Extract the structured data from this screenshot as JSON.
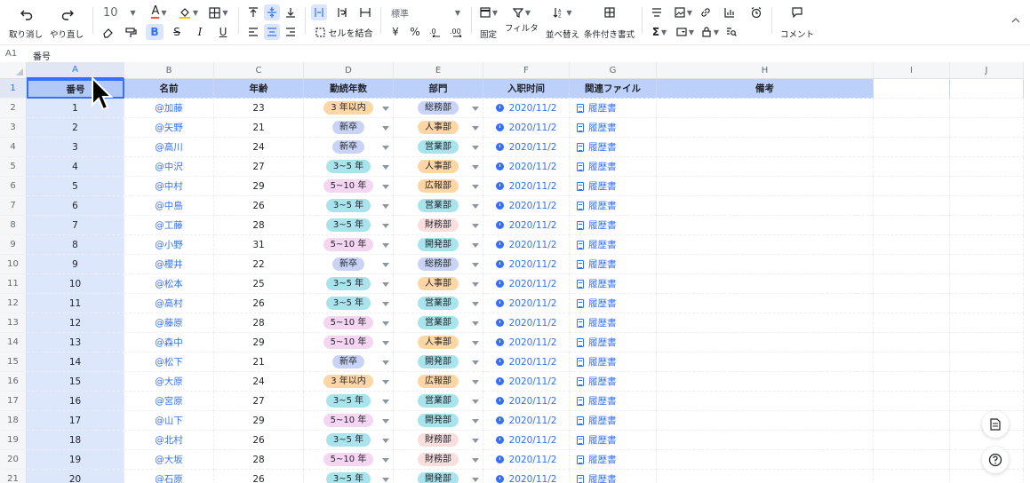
{
  "formula_bar": {
    "cell_ref": "A1",
    "content": "番号"
  },
  "toolbar": {
    "undo_label": "取り消し",
    "redo_label": "やり直し",
    "font_size": "10",
    "font_color_icon": "A",
    "merge_label": "セルを結合",
    "number_format": "標準",
    "currency_symbol": "¥",
    "percent_symbol": "%",
    "freeze_label": "固定",
    "filter_label": "フィルタ",
    "sort_label": "並べ替え",
    "conditional_format_label": "条件付き書式",
    "comment_label": "コメント",
    "sum_symbol": "Σ",
    "accent": "#3370ff"
  },
  "columns": [
    "A",
    "B",
    "C",
    "D",
    "E",
    "F",
    "G",
    "H",
    "I",
    "J"
  ],
  "headers": [
    "番号",
    "名前",
    "年齢",
    "勤続年数",
    "部門",
    "入职时间",
    "関連ファイル",
    "備考"
  ],
  "rows": [
    {
      "row": "1"
    },
    {
      "row": "2",
      "no": "1",
      "name": "@加藤",
      "age": "23",
      "tenure": "3 年以内",
      "dept": "総務部",
      "date": "2020/11/2",
      "file": "履歴書"
    },
    {
      "row": "3",
      "no": "2",
      "name": "@矢野",
      "age": "21",
      "tenure": "新卒",
      "dept": "人事部",
      "date": "2020/11/2",
      "file": "履歴書"
    },
    {
      "row": "4",
      "no": "3",
      "name": "@高川",
      "age": "24",
      "tenure": "新卒",
      "dept": "営業部",
      "date": "2020/11/2",
      "file": "履歴書"
    },
    {
      "row": "5",
      "no": "4",
      "name": "@中沢",
      "age": "27",
      "tenure": "3~5 年",
      "dept": "人事部",
      "date": "2020/11/2",
      "file": "履歴書"
    },
    {
      "row": "6",
      "no": "5",
      "name": "@中村",
      "age": "29",
      "tenure": "5~10 年",
      "dept": "広報部",
      "date": "2020/11/2",
      "file": "履歴書"
    },
    {
      "row": "7",
      "no": "6",
      "name": "@中島",
      "age": "26",
      "tenure": "3~5 年",
      "dept": "営業部",
      "date": "2020/11/2",
      "file": "履歴書"
    },
    {
      "row": "8",
      "no": "7",
      "name": "@工藤",
      "age": "28",
      "tenure": "3~5 年",
      "dept": "財務部",
      "date": "2020/11/2",
      "file": "履歴書"
    },
    {
      "row": "9",
      "no": "8",
      "name": "@小野",
      "age": "31",
      "tenure": "5~10 年",
      "dept": "開発部",
      "date": "2020/11/2",
      "file": "履歴書"
    },
    {
      "row": "10",
      "no": "9",
      "name": "@櫻井",
      "age": "22",
      "tenure": "新卒",
      "dept": "総務部",
      "date": "2020/11/2",
      "file": "履歴書"
    },
    {
      "row": "11",
      "no": "10",
      "name": "@松本",
      "age": "25",
      "tenure": "3~5 年",
      "dept": "人事部",
      "date": "2020/11/2",
      "file": "履歴書"
    },
    {
      "row": "12",
      "no": "11",
      "name": "@高村",
      "age": "26",
      "tenure": "3~5 年",
      "dept": "営業部",
      "date": "2020/11/2",
      "file": "履歴書"
    },
    {
      "row": "13",
      "no": "12",
      "name": "@藤原",
      "age": "28",
      "tenure": "5~10 年",
      "dept": "営業部",
      "date": "2020/11/2",
      "file": "履歴書"
    },
    {
      "row": "14",
      "no": "13",
      "name": "@森中",
      "age": "29",
      "tenure": "5~10 年",
      "dept": "人事部",
      "date": "2020/11/2",
      "file": "履歴書"
    },
    {
      "row": "15",
      "no": "14",
      "name": "@松下",
      "age": "21",
      "tenure": "新卒",
      "dept": "開発部",
      "date": "2020/11/2",
      "file": "履歴書"
    },
    {
      "row": "16",
      "no": "15",
      "name": "@大原",
      "age": "24",
      "tenure": "3 年以内",
      "dept": "広報部",
      "date": "2020/11/2",
      "file": "履歴書"
    },
    {
      "row": "17",
      "no": "16",
      "name": "@宮原",
      "age": "27",
      "tenure": "3~5 年",
      "dept": "営業部",
      "date": "2020/11/2",
      "file": "履歴書"
    },
    {
      "row": "18",
      "no": "17",
      "name": "@山下",
      "age": "29",
      "tenure": "5~10 年",
      "dept": "開発部",
      "date": "2020/11/2",
      "file": "履歴書"
    },
    {
      "row": "19",
      "no": "18",
      "name": "@北村",
      "age": "26",
      "tenure": "3~5 年",
      "dept": "財務部",
      "date": "2020/11/2",
      "file": "履歴書"
    },
    {
      "row": "20",
      "no": "19",
      "name": "@大坂",
      "age": "28",
      "tenure": "5~10 年",
      "dept": "財務部",
      "date": "2020/11/2",
      "file": "履歴書"
    },
    {
      "row": "21",
      "no": "20",
      "name": "@石原",
      "age": "26",
      "tenure": "3~5 年",
      "dept": "開発部",
      "date": "2020/11/2",
      "file": "履歴書"
    }
  ],
  "tenure_colors": {
    "3 年以内": "#fdd6a6",
    "新卒": "#c8d3f5",
    "3~5 年": "#a9e3ec",
    "5~10 年": "#f5d6f2"
  },
  "dept_colors": {
    "総務部": "#c8d3f5",
    "人事部": "#fdd6a6",
    "営業部": "#a9e3ec",
    "広報部": "#fdd6a6",
    "財務部": "#f9dede",
    "開発部": "#a9e3ec"
  }
}
